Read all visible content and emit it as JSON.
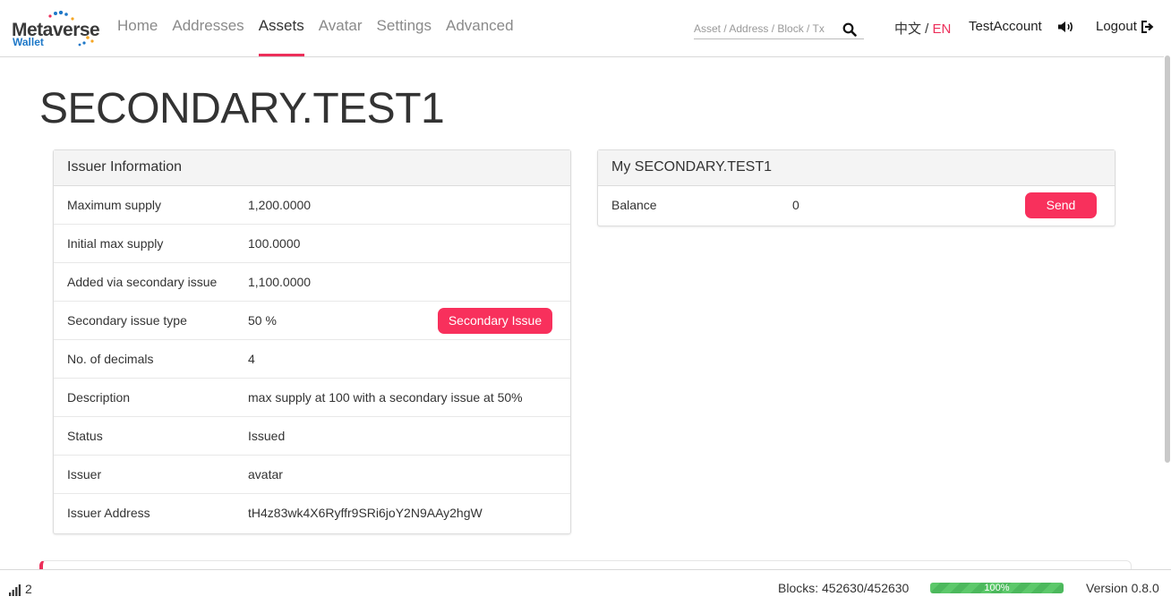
{
  "brand": {
    "name": "Metaverse",
    "sub": "Wallet"
  },
  "nav": {
    "items": [
      "Home",
      "Addresses",
      "Assets",
      "Avatar",
      "Settings",
      "Advanced"
    ],
    "active": "Assets"
  },
  "search": {
    "placeholder": "Asset / Address / Block / Tx",
    "icon": "search-icon"
  },
  "lang": {
    "zh": "中文",
    "separator": " / ",
    "en": "EN"
  },
  "account": "TestAccount",
  "logout": "Logout",
  "page": {
    "title": "SECONDARY.TEST1"
  },
  "issuer": {
    "heading": "Issuer Information",
    "rows": [
      {
        "label": "Maximum supply",
        "value": "1,200.0000"
      },
      {
        "label": "Initial max supply",
        "value": "100.0000"
      },
      {
        "label": "Added via secondary issue",
        "value": "1,100.0000"
      },
      {
        "label": "Secondary issue type",
        "value": "50 %"
      },
      {
        "label": "No. of decimals",
        "value": "4"
      },
      {
        "label": "Description",
        "value": "max supply at 100 with a secondary issue at 50%"
      },
      {
        "label": "Status",
        "value": "Issued"
      },
      {
        "label": "Issuer",
        "value": "avatar"
      },
      {
        "label": "Issuer Address",
        "value": "tH4z83wk4X6Ryffr9SRi6joY2N9AAy2hgW"
      }
    ],
    "secondary_issue_button": "Secondary Issue"
  },
  "my_asset": {
    "heading": "My SECONDARY.TEST1",
    "balance_label": "Balance",
    "balance_value": "0",
    "send_button": "Send"
  },
  "footer": {
    "peers": "2",
    "blocks": "Blocks: 452630/452630",
    "progress_label": "100%",
    "progress_fraction": 1.0,
    "version": "Version 0.8.0"
  },
  "colors": {
    "accent": "#ec2f5a",
    "button": "#f8305c",
    "progress": "#4cb85c"
  }
}
